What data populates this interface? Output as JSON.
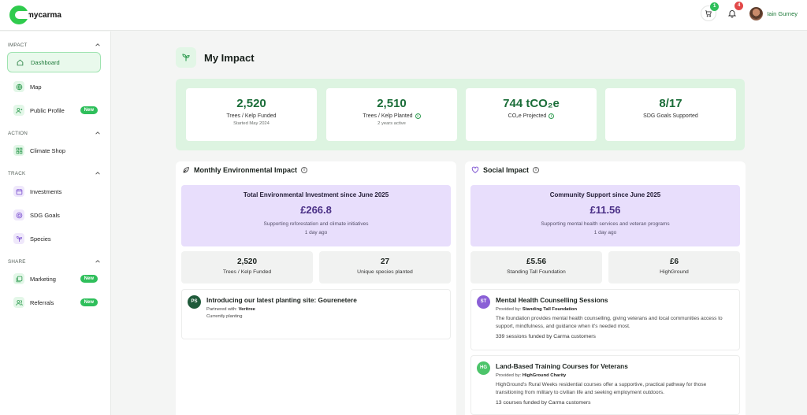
{
  "app": {
    "logo_text": "mycarma",
    "user_name": "Iain Gurney",
    "cart_count": "1",
    "notif_count": "4"
  },
  "sidebar": {
    "sections": [
      {
        "label": "IMPACT"
      },
      {
        "label": "ACTION"
      },
      {
        "label": "TRACK"
      },
      {
        "label": "SHARE"
      }
    ],
    "items": [
      {
        "label": "Dashboard"
      },
      {
        "label": "Map"
      },
      {
        "label": "Public Profile",
        "badge": "New"
      },
      {
        "label": "Climate Shop"
      },
      {
        "label": "Investments"
      },
      {
        "label": "SDG Goals"
      },
      {
        "label": "Species"
      },
      {
        "label": "Marketing",
        "badge": "New"
      },
      {
        "label": "Referrals",
        "badge": "New"
      }
    ]
  },
  "page": {
    "title": "My Impact"
  },
  "stats": [
    {
      "value": "2,520",
      "label": "Trees / Kelp Funded",
      "sub": "Started May 2024"
    },
    {
      "value": "2,510",
      "label": "Trees / Kelp Planted",
      "sub": "2 years active"
    },
    {
      "value": "744 tCO₂e",
      "label": "CO₂e Projected",
      "sub": ""
    },
    {
      "value": "8/17",
      "label": "SDG Goals Supported",
      "sub": ""
    }
  ],
  "env": {
    "title": "Monthly Environmental Impact",
    "hero_title": "Total Environmental Investment since June 2025",
    "hero_value": "£266.8",
    "hero_desc": "Supporting reforestation and climate initiatives",
    "hero_time": "1 day ago",
    "mini": [
      {
        "value": "2,520",
        "label": "Trees / Kelp Funded"
      },
      {
        "value": "27",
        "label": "Unique species planted"
      }
    ],
    "card": {
      "initials": "PS",
      "title": "Introducing our latest planting site: Gourenetere",
      "partner_prefix": "Partnered with:",
      "partner": "Veritree",
      "status": "Currently planting"
    }
  },
  "social": {
    "title": "Social Impact",
    "hero_title": "Community Support since June 2025",
    "hero_value": "£11.56",
    "hero_desc": "Supporting mental health services and veteran programs",
    "hero_time": "1 day ago",
    "mini": [
      {
        "value": "£5.56",
        "label": "Standing Tall Foundation"
      },
      {
        "value": "£6",
        "label": "HighGround"
      }
    ],
    "cards": [
      {
        "initials": "ST",
        "title": "Mental Health Counselling Sessions",
        "provider_prefix": "Provided by:",
        "provider": "Standing Tall Foundation",
        "desc": "The foundation provides mental health counselling, giving veterans and local communities access to support, mindfulness, and guidance when it's needed most.",
        "foot": "339 sessions funded by Carma customers"
      },
      {
        "initials": "HG",
        "title": "Land-Based Training Courses for Veterans",
        "provider_prefix": "Provided by:",
        "provider": "HighGround Charity",
        "desc": "HighGround's Rural Weeks residential courses offer a supportive, practical pathway for those transitioning from military to civilian life and seeking employment outdoors.",
        "foot": "13 courses funded by Carma customers"
      }
    ]
  },
  "colors": {
    "brand_green": "#2fcb4d",
    "dark_green": "#1a6d38",
    "purple_bg": "#e8defc",
    "purple_text": "#4a2f86"
  }
}
